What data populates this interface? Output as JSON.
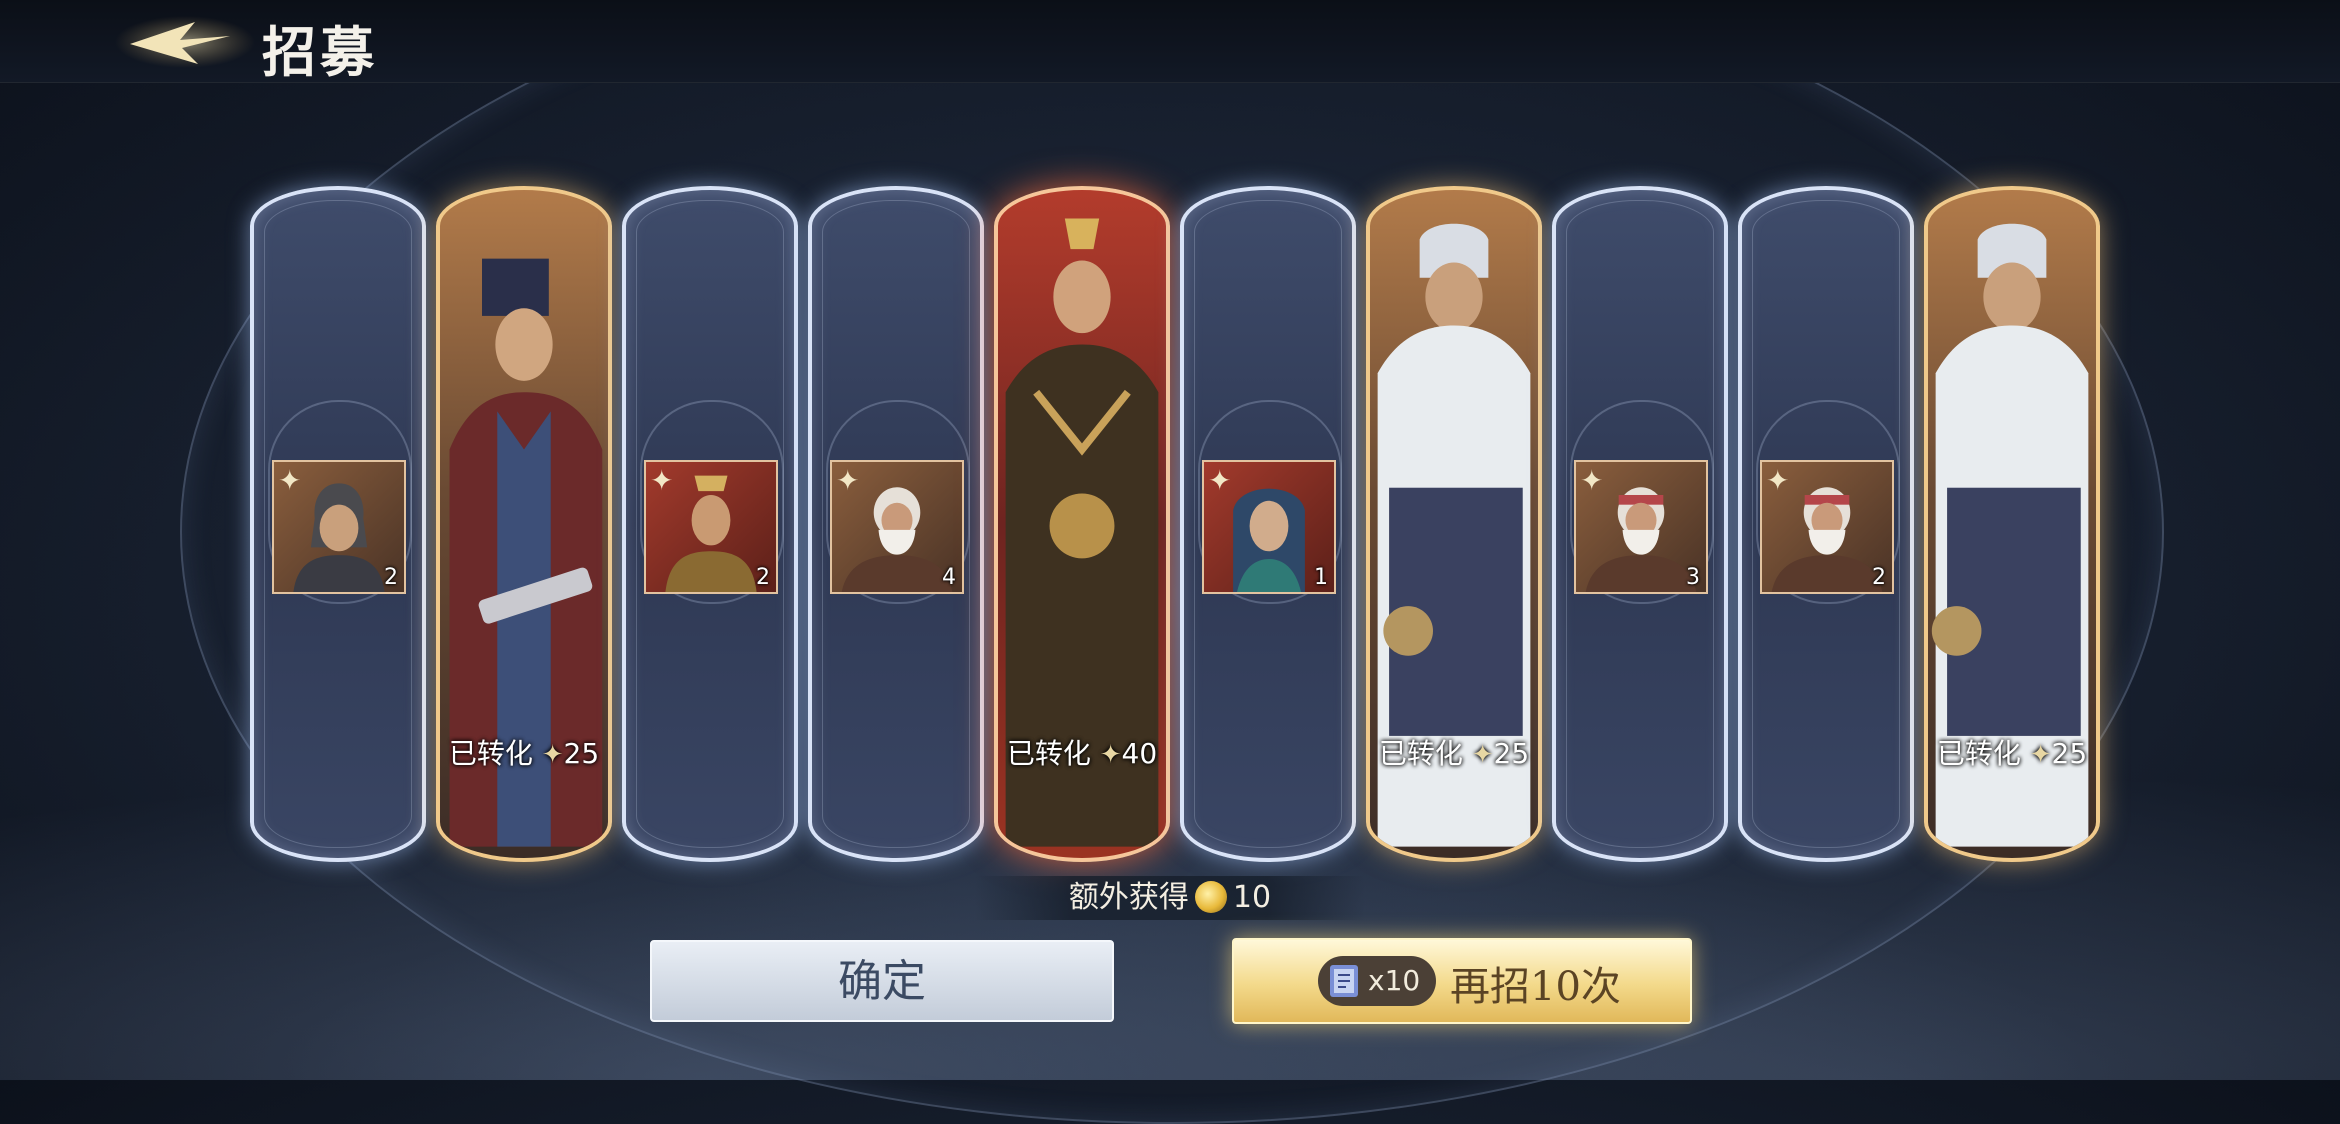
{
  "header": {
    "title": "招募"
  },
  "cards": [
    {
      "type": "piece",
      "frame": "blue",
      "count": "2"
    },
    {
      "type": "hero",
      "frame": "gold",
      "converted_label": "已转化",
      "fragments": "25"
    },
    {
      "type": "piece",
      "frame": "blue",
      "count": "2"
    },
    {
      "type": "piece",
      "frame": "blue",
      "count": "4"
    },
    {
      "type": "hero",
      "frame": "red",
      "converted_label": "已转化",
      "fragments": "40"
    },
    {
      "type": "piece",
      "frame": "blue",
      "count": "1"
    },
    {
      "type": "hero",
      "frame": "gold",
      "converted_label": "已转化",
      "fragments": "25"
    },
    {
      "type": "piece",
      "frame": "blue",
      "count": "3"
    },
    {
      "type": "piece",
      "frame": "blue",
      "count": "2"
    },
    {
      "type": "hero",
      "frame": "gold",
      "converted_label": "已转化",
      "fragments": "25"
    }
  ],
  "bonus": {
    "label": "额外获得",
    "amount": "10"
  },
  "buttons": {
    "confirm": "确定",
    "again": "再招10次",
    "ticket_count": "x10"
  },
  "colors": {
    "blue_frame": "#d9e3f7",
    "gold_frame": "#f0c98a",
    "red_frame": "#f6c69a"
  }
}
